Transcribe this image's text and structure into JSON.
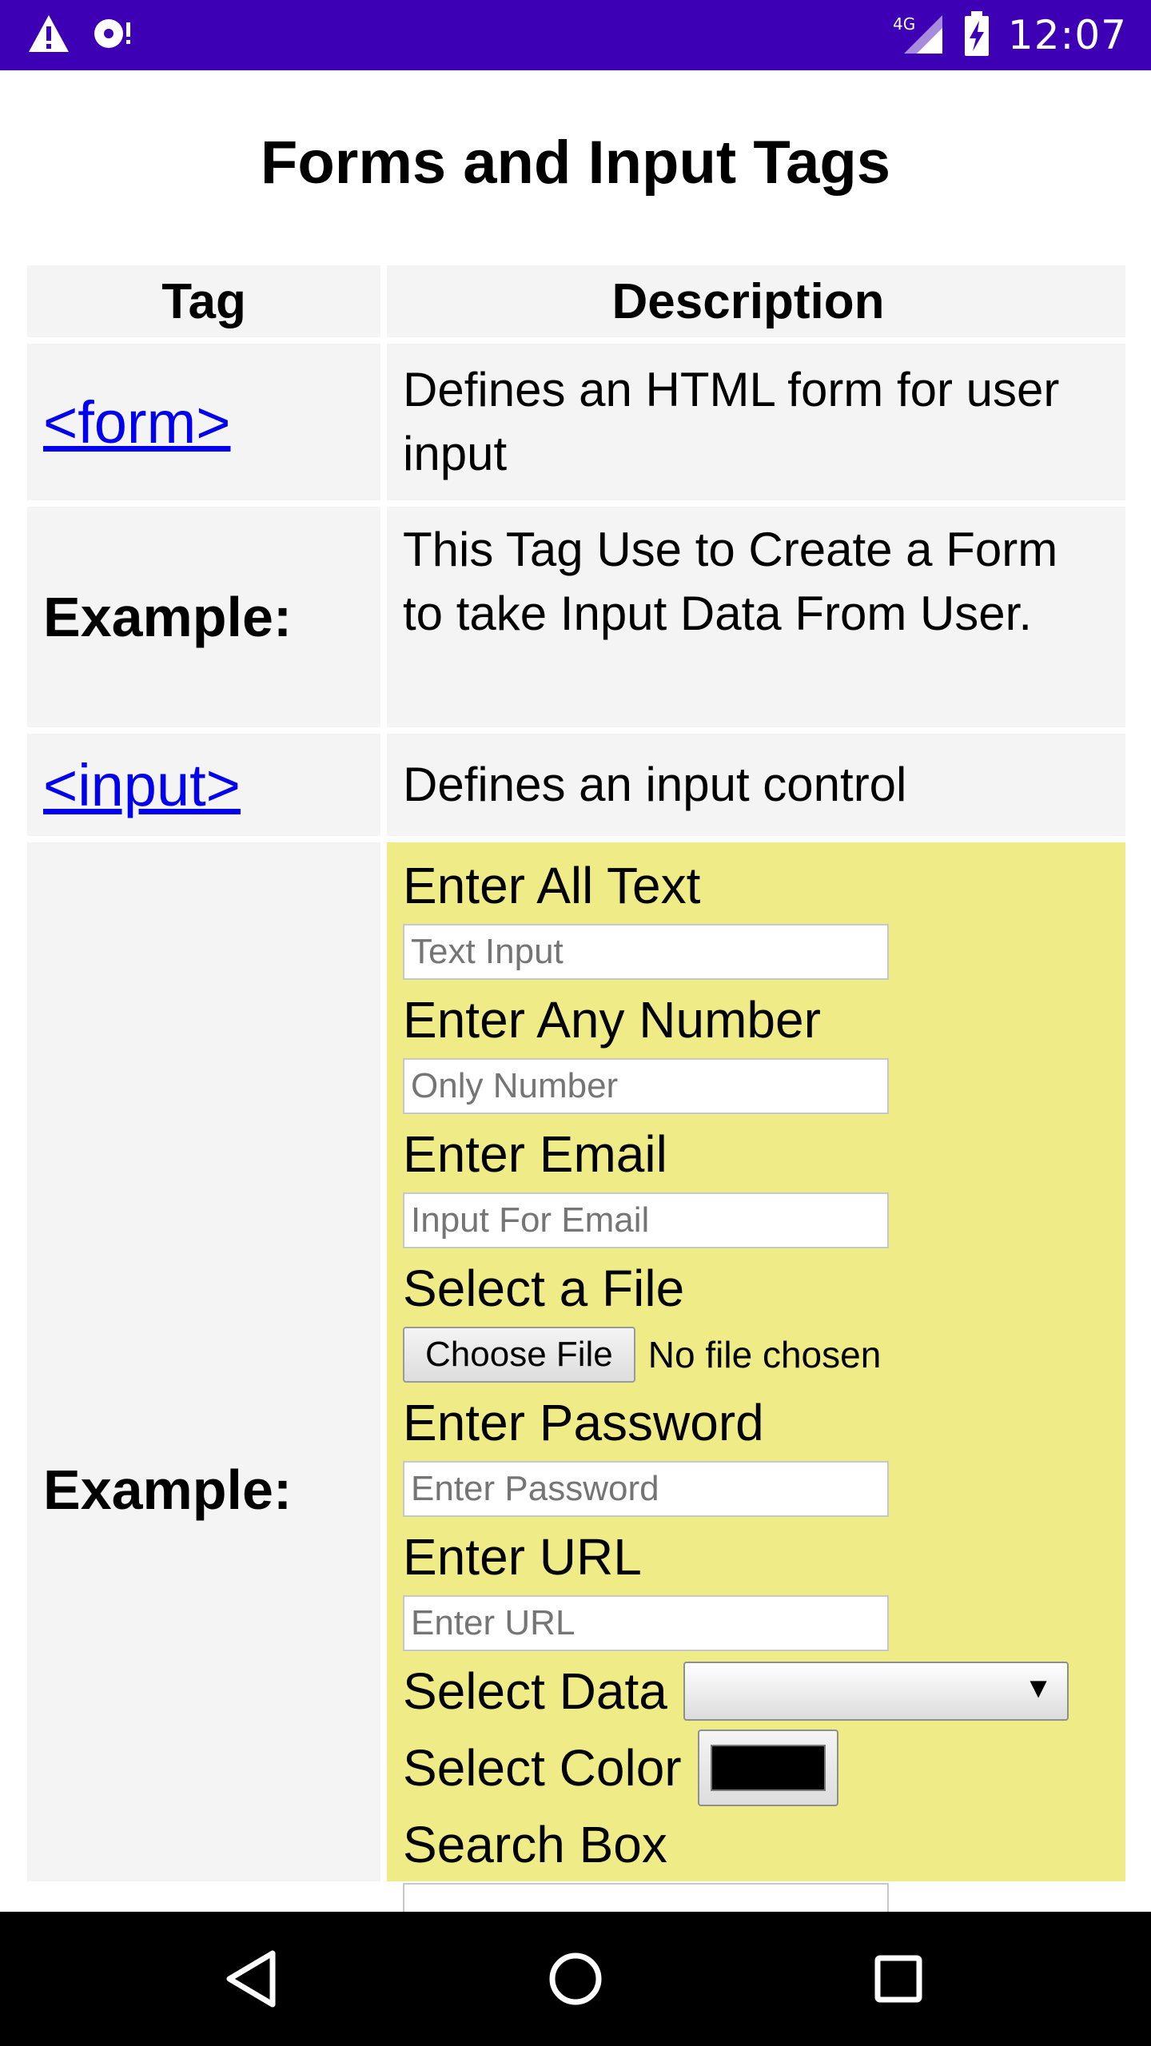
{
  "status_bar": {
    "time": "12:07",
    "network": "4G",
    "icons": [
      "warning-icon",
      "notification-icon",
      "signal-icon",
      "battery-charging-icon"
    ]
  },
  "page": {
    "title": "Forms and Input Tags"
  },
  "table": {
    "headers": {
      "tag": "Tag",
      "description": "Description"
    },
    "rows": [
      {
        "tag": "<form>",
        "description": "Defines an HTML form for user input"
      },
      {
        "tag": "Example:",
        "description": "This Tag Use to Create a Form to take Input Data From User."
      },
      {
        "tag": "<input>",
        "description": "Defines an input control"
      },
      {
        "tag": "Example:"
      }
    ]
  },
  "form": {
    "text_label": "Enter All Text",
    "text_placeholder": "Text Input",
    "number_label": "Enter Any Number",
    "number_placeholder": "Only Number",
    "email_label": "Enter Email",
    "email_placeholder": "Input For Email",
    "file_label": "Select a File",
    "file_button": "Choose File",
    "file_status": "No file chosen",
    "password_label": "Enter Password",
    "password_placeholder": "Enter Password",
    "url_label": "Enter URL",
    "url_placeholder": "Enter URL",
    "select_label": "Select Data",
    "color_label": "Select Color",
    "color_value": "#000000",
    "search_label": "Search Box"
  },
  "colors": {
    "status_bar": "#3d00b4",
    "form_background": "#efec88",
    "link": "#0000ee",
    "cell_background": "#f4f4f4"
  },
  "nav_bar": {
    "icons": [
      "back-icon",
      "home-icon",
      "recents-icon"
    ]
  }
}
